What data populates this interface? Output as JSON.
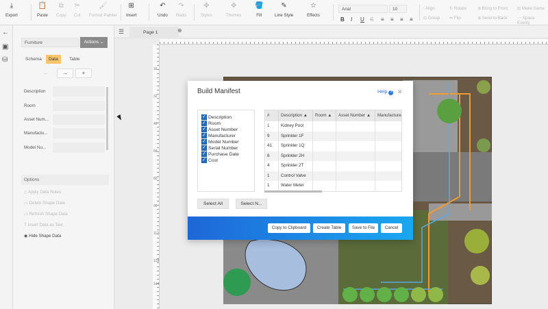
{
  "toolbar": {
    "export": "Export",
    "paste": "Paste",
    "copy": "Copy",
    "cut": "Cut",
    "format_painter": "Format Painter",
    "insert": "Insert",
    "undo": "Undo",
    "redo": "Redo",
    "styles": "Styles",
    "themes": "Themes",
    "fill": "Fill",
    "line_style": "Line Style",
    "effects": "Effects",
    "font_name": "Arial",
    "font_size": "10",
    "bold": "B",
    "italic": "I",
    "underline": "U",
    "strike": "S",
    "align": "≡",
    "align_v": "≡",
    "align_list": "≡",
    "align_list2": "≡",
    "align_btn": "Align",
    "group": "Group",
    "rotate": "Rotate",
    "flip": "Flip",
    "bring_to_front": "Bring to Front",
    "send_to_back": "Send to Back",
    "make_same": "Make Same",
    "space_evenly": "Space Evenly"
  },
  "panel": {
    "dataset": "Furniture",
    "actions": "Actions",
    "tabs": [
      "Schema",
      "Data",
      "Table"
    ],
    "prev": "←",
    "next": "→",
    "add": "+",
    "fields": [
      "Description",
      "Room",
      "Asset Num...",
      "Manufactu...",
      "Model Nu..."
    ],
    "options_header": "Options",
    "options": [
      "Apply Data Rules",
      "Delete Shape Data",
      "Refresh Shape Data",
      "Insert Data as Text",
      "Hide Shape Data"
    ]
  },
  "page_tab": "Page 1",
  "ruler_labels": [
    "16",
    "32",
    "48",
    "64",
    "80",
    "96",
    "112",
    "128",
    "144"
  ],
  "dialog": {
    "title": "Build Manifest",
    "help": "Help",
    "help_icon": "?",
    "close": "✕",
    "columns": [
      "Description",
      "Room",
      "Asset Number",
      "Manufacturer",
      "Model Number",
      "Serial Number",
      "Purchase Date",
      "Cost"
    ],
    "check": "✓",
    "grid_headers": [
      "#",
      "Description",
      "Room",
      "Asset Number",
      "Manufacturer"
    ],
    "rows": [
      [
        "1",
        "Kidney Pool"
      ],
      [
        "9",
        "Sprinkler 1F"
      ],
      [
        "41",
        "Sprinkler 1Q"
      ],
      [
        "8",
        "Sprinkler 2H"
      ],
      [
        "4",
        "Sprinkler 2T"
      ],
      [
        "1",
        "Control Valve"
      ],
      [
        "1",
        "Water Meter"
      ]
    ],
    "select_all": "Select All",
    "select_none": "Select N...",
    "copy_clipboard": "Copy to Clipboard",
    "create_table": "Create Table",
    "save_file": "Save to File",
    "cancel": "Cancel"
  },
  "colors": {
    "accent": "#2b6cb8",
    "footer_start": "#1e67d8",
    "footer_end": "#1aa7f0",
    "active_tab": "#f7c66a",
    "lawn": "#6a5a45",
    "patio": "#7a7a7a",
    "pool": "#a7bedf",
    "orange_pipe": "#f29b30",
    "blue_pipe": "#59a9e8"
  }
}
